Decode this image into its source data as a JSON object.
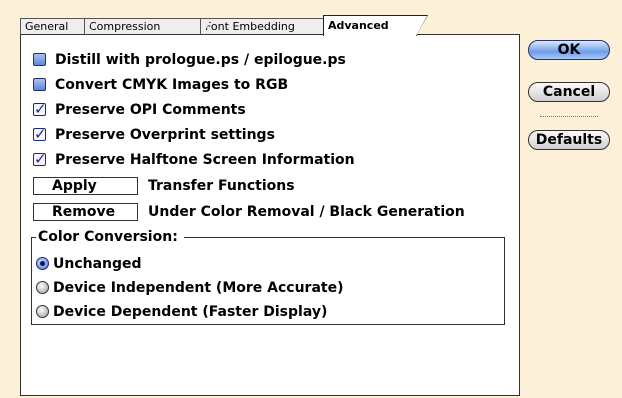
{
  "tabs": [
    {
      "label": "General"
    },
    {
      "label": "Compression"
    },
    {
      "label": "Font Embedding"
    },
    {
      "label": "Advanced",
      "active": true
    }
  ],
  "options": [
    {
      "label": "Distill with prologue.ps / epilogue.ps",
      "checked": false
    },
    {
      "label": "Convert CMYK Images to RGB",
      "checked": false
    },
    {
      "label": "Preserve OPI Comments",
      "checked": true
    },
    {
      "label": "Preserve Overprint settings",
      "checked": true
    },
    {
      "label": "Preserve Halftone Screen Information",
      "checked": true
    }
  ],
  "transfer": {
    "button_label": "Apply",
    "label": "Transfer Functions"
  },
  "ucr": {
    "button_label": "Remove",
    "label": "Under Color Removal / Black Generation"
  },
  "color_conversion": {
    "title": "Color Conversion:",
    "choices": [
      {
        "label": "Unchanged",
        "selected": true
      },
      {
        "label": "Device Independent (More Accurate)",
        "selected": false
      },
      {
        "label": "Device Dependent (Faster Display)",
        "selected": false
      }
    ]
  },
  "buttons": {
    "ok": "OK",
    "cancel": "Cancel",
    "defaults": "Defaults"
  },
  "colors": {
    "background": "#fcf1d8",
    "checkbox_blue": "#5f86d6",
    "check_mark": "#1d2d8f"
  }
}
